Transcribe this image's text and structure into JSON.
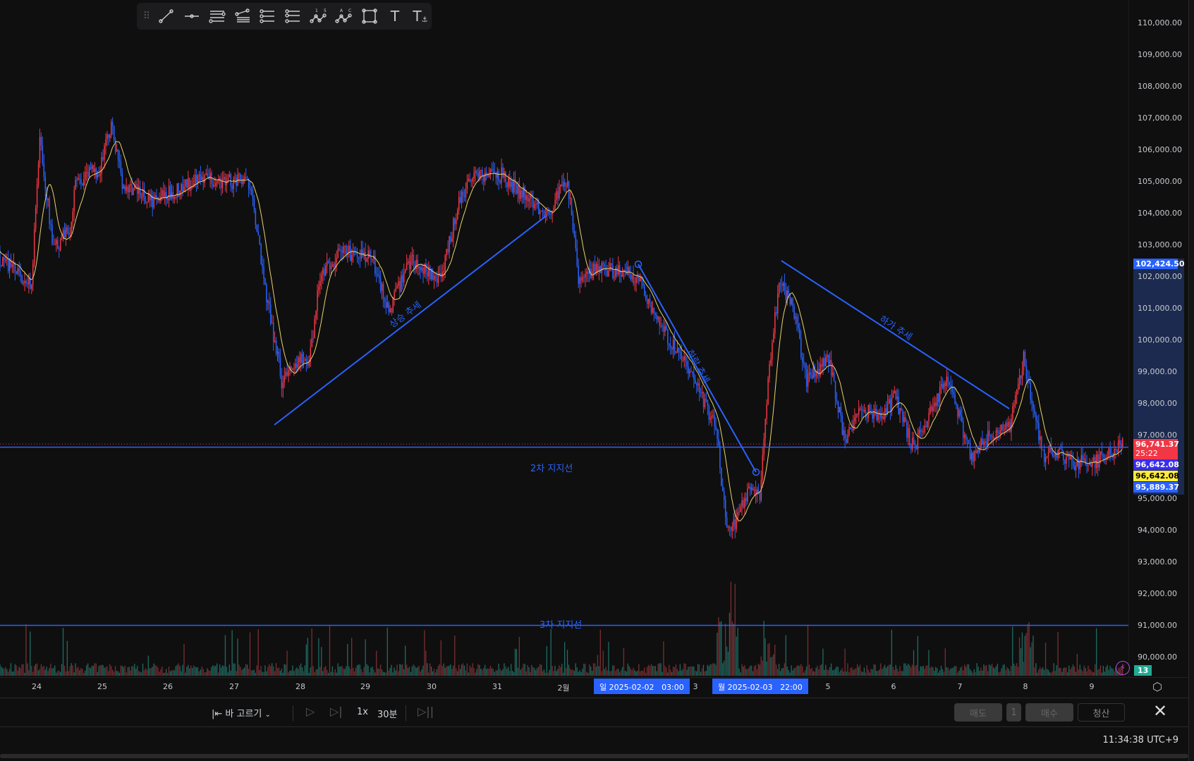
{
  "toolbar": {
    "tools": [
      "drag-handle",
      "trend-line",
      "horizontal-ray",
      "parallel-channel",
      "pitchfork",
      "fib-retracement",
      "fib-extension",
      "elliott-wave",
      "abcd-pattern",
      "rectangle",
      "text",
      "anchored-text"
    ],
    "wave_labels": [
      "1",
      "5"
    ],
    "abcd_labels": [
      "A",
      "C"
    ],
    "text_glyph": "T"
  },
  "price_axis": {
    "ticks": [
      "110,000.00",
      "109,000.00",
      "108,000.00",
      "107,000.00",
      "106,000.00",
      "105,000.00",
      "104,000.00",
      "103,000.00",
      "102,000.00",
      "101,000.00",
      "100,000.00",
      "99,000.00",
      "98,000.00",
      "97,000.00",
      "95,000.00",
      "94,000.00",
      "93,000.00",
      "92,000.00",
      "91,000.00",
      "90,000.00"
    ],
    "tags": [
      {
        "text": "102,424.50",
        "color": "#2962ff",
        "price": 102424.5
      },
      {
        "text": "96,741.37",
        "sub": "25:22",
        "color": "#f23645",
        "price": 96741.37
      },
      {
        "text": "96,642.08",
        "color": "#3a2cf0",
        "price": 96642.08
      },
      {
        "text": "96,642.08",
        "color": "#ffeb3b",
        "price": 96642.08
      },
      {
        "text": "95,889.37",
        "color": "#2962ff",
        "price": 95889.37
      }
    ],
    "volume_badge": "13",
    "volume_badge_color": "#22ab94"
  },
  "time_axis": {
    "ticks": [
      "24",
      "25",
      "26",
      "27",
      "28",
      "29",
      "30",
      "31",
      "2월",
      "3",
      "5",
      "6",
      "7",
      "8",
      "9"
    ],
    "selected": [
      {
        "day": "일",
        "date": "2025-02-02",
        "time": "03:00"
      },
      {
        "day": "월",
        "date": "2025-02-03",
        "time": "22:00"
      }
    ]
  },
  "drawings": {
    "uptrend": "상승 추세",
    "downtrend": "하락 추세",
    "downtrend2": "하가 추세",
    "support2": "2차 지지선",
    "support3": "3차 지지선",
    "support2_price": 96642.08,
    "support3_price": 91000,
    "line_color": "#2962ff"
  },
  "replay": {
    "select_bar": "바 고르기",
    "speed": "1x",
    "interval": "30분"
  },
  "trading": {
    "sell": "매도",
    "qty": "1",
    "buy": "매수",
    "close": "청산"
  },
  "status": {
    "clock": "11:34:38 UTC+9"
  },
  "chart_data": {
    "type": "candlestick",
    "interval": "30분",
    "up_color": "#f23645",
    "down_color": "#2962ff",
    "ma_color": "#e8d36b",
    "ylim": [
      89500,
      110500
    ],
    "approx_close": [
      [
        "01-23 11:00",
        102580
      ],
      [
        "01-23 22:00",
        101740
      ],
      [
        "01-24 01:00",
        106420
      ],
      [
        "01-24 06:00",
        102820
      ],
      [
        "01-24 12:00",
        103540
      ],
      [
        "01-24 14:00",
        104980
      ],
      [
        "01-24 23:00",
        105460
      ],
      [
        "01-25 03:00",
        106780
      ],
      [
        "01-25 07:00",
        104980
      ],
      [
        "01-25 18:00",
        104380
      ],
      [
        "01-26 05:00",
        104860
      ],
      [
        "01-26 13:00",
        105100
      ],
      [
        "01-27 06:00",
        104980
      ],
      [
        "01-27 10:00",
        102100
      ],
      [
        "01-27 17:00",
        98740
      ],
      [
        "01-27 23:00",
        99460
      ],
      [
        "01-28 03:00",
        99220
      ],
      [
        "01-28 07:00",
        102100
      ],
      [
        "01-28 15:00",
        102820
      ],
      [
        "01-29 02:00",
        102580
      ],
      [
        "01-29 08:00",
        100900
      ],
      [
        "01-29 16:00",
        102580
      ],
      [
        "01-30 03:00",
        101860
      ],
      [
        "01-30 09:00",
        104260
      ],
      [
        "01-30 14:00",
        105220
      ],
      [
        "01-31 01:00",
        105220
      ],
      [
        "01-31 12:00",
        104380
      ],
      [
        "01-31 18:00",
        104020
      ],
      [
        "02-01 01:00",
        105100
      ],
      [
        "02-01 05:00",
        101860
      ],
      [
        "02-01 13:00",
        102340
      ],
      [
        "02-02 03:00",
        101980
      ],
      [
        "02-02 11:00",
        100420
      ],
      [
        "02-02 20:00",
        99220
      ],
      [
        "02-03 07:00",
        97300
      ],
      [
        "02-03 11:00",
        93940
      ],
      [
        "02-03 15:00",
        94420
      ],
      [
        "02-03 19:00",
        95380
      ],
      [
        "02-03 23:00",
        95140
      ],
      [
        "02-04 02:00",
        98740
      ],
      [
        "02-04 06:00",
        101860
      ],
      [
        "02-04 11:00",
        101140
      ],
      [
        "02-04 16:00",
        98740
      ],
      [
        "02-05 00:00",
        99460
      ],
      [
        "02-05 06:00",
        96820
      ],
      [
        "02-05 12:00",
        97780
      ],
      [
        "02-05 20:00",
        97660
      ],
      [
        "02-06 00:00",
        98260
      ],
      [
        "02-06 07:00",
        96580
      ],
      [
        "02-06 19:00",
        98860
      ],
      [
        "02-07 04:00",
        96340
      ],
      [
        "02-07 11:00",
        97060
      ],
      [
        "02-07 18:00",
        97300
      ],
      [
        "02-07 23:00",
        99460
      ],
      [
        "02-08 06:00",
        96340
      ],
      [
        "02-08 10:00",
        96580
      ],
      [
        "02-08 17:00",
        96100
      ],
      [
        "02-09 02:00",
        96220
      ],
      [
        "02-09 11:00",
        96740
      ]
    ]
  }
}
